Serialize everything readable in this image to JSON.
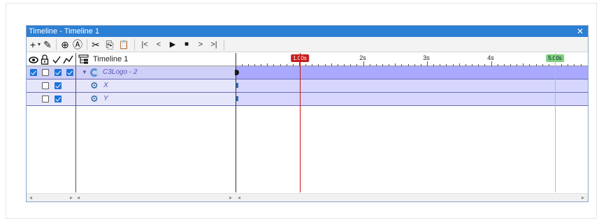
{
  "window": {
    "title": "Timeline - Timeline 1",
    "close_glyph": "✕"
  },
  "toolbar": {
    "add": "+",
    "add_dropdown": "▾",
    "edit": "✎",
    "add_keyframe": "⊕",
    "auto": "Ⓐ",
    "cut": "✂",
    "copy": "⎘",
    "paste": "📋",
    "go_start": "|<",
    "step_back": "<",
    "play": "▶",
    "stop": "■",
    "step_forward": ">",
    "go_end": ">|"
  },
  "header": {
    "visibility_icon": "eye-icon",
    "lock_icon": "lock-icon",
    "check_icon": "checkmark-icon",
    "curve_icon": "curve-icon",
    "tree_icon": "tree-icon",
    "timeline_name": "Timeline 1"
  },
  "ruler": {
    "labels": [
      "2s",
      "3s",
      "4s"
    ],
    "playhead_label": "1.00s",
    "end_label": "5.00s"
  },
  "tracks": [
    {
      "name": "C3Logo - 2",
      "visible": true,
      "locked": false,
      "enabled": true,
      "curve": true
    },
    {
      "name": "X",
      "locked": false,
      "enabled": true
    },
    {
      "name": "Y",
      "locked": false,
      "enabled": true
    }
  ],
  "colors": {
    "titlebar": "#2b7fd4",
    "track_header_lane": "#a9a9ff",
    "property_lane": "#d6d6ff",
    "playhead": "#d01414",
    "end_marker": "#7fd07f"
  }
}
